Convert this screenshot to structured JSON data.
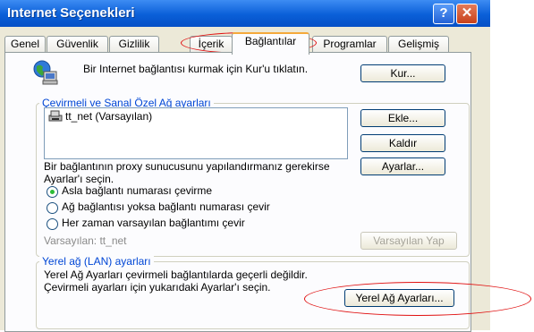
{
  "window": {
    "title": "Internet Seçenekleri",
    "help_glyph": "?",
    "close_glyph": "✕"
  },
  "tabs": [
    {
      "label": "Genel"
    },
    {
      "label": "Güvenlik"
    },
    {
      "label": "Gizlilik"
    },
    {
      "label": "İçerik"
    },
    {
      "label": "Bağlantılar"
    },
    {
      "label": "Programlar"
    },
    {
      "label": "Gelişmiş"
    }
  ],
  "active_tab": "Bağlantılar",
  "setup": {
    "text": "Bir Internet bağlantısı kurmak için Kur'u tıklatın.",
    "button": "Kur..."
  },
  "dialup": {
    "group_label": "Çevirmeli ve Sanal Özel Ağ ayarları",
    "connections": [
      "tt_net (Varsayılan)"
    ],
    "add_button": "Ekle...",
    "remove_button": "Kaldır",
    "settings_button": "Ayarlar...",
    "proxy_text": "Bir bağlantının proxy sunucusunu yapılandırmanız gerekirse Ayarlar'ı seçin.",
    "radio_options": [
      {
        "label": "Asla bağlantı numarası çevirme",
        "selected": true
      },
      {
        "label": "Ağ bağlantısı yoksa bağlantı numarası çevir",
        "selected": false
      },
      {
        "label": "Her zaman varsayılan bağlantımı çevir",
        "selected": false
      }
    ],
    "default_text": "Varsayılan:  tt_net",
    "set_default_button": "Varsayılan Yap"
  },
  "lan": {
    "group_label": "Yerel ağ (LAN) ayarları",
    "text": "Yerel Ağ Ayarları çevirmeli bağlantılarda geçerli değildir. Çevirmeli ayarları için yukarıdaki Ayarlar'ı seçin.",
    "button": "Yerel Ağ Ayarları..."
  },
  "colors": {
    "title_bar": "#0a5fd8",
    "group_label": "#0046d5",
    "annotation": "#e01010",
    "radio_selected": "#2dbc38"
  }
}
